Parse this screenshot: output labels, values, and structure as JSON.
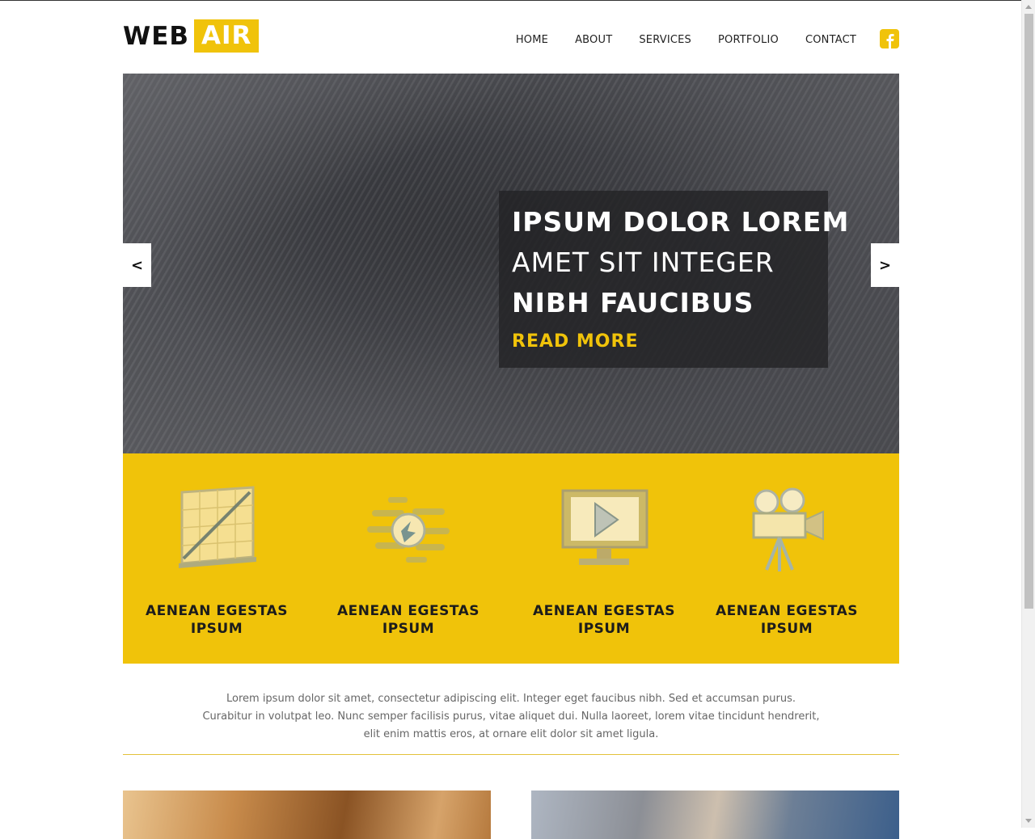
{
  "brand": {
    "part1": "WEB",
    "part2": "AIR",
    "accent": "#f0c30a"
  },
  "nav": {
    "items": [
      "HOME",
      "ABOUT",
      "SERVICES",
      "PORTFOLIO",
      "CONTACT"
    ],
    "social_icon": "facebook-icon"
  },
  "hero": {
    "line1": "IPSUM DOLOR LOREM",
    "line2": "AMET SIT INTEGER",
    "line3": "NIBH FAUCIBUS",
    "cta": "READ MORE",
    "prev": "<",
    "next": ">"
  },
  "features": [
    {
      "icon": "chart-icon",
      "line1": "AENEAN EGESTAS",
      "line2": "IPSUM"
    },
    {
      "icon": "globe-icon",
      "line1": "AENEAN EGESTAS",
      "line2": "IPSUM"
    },
    {
      "icon": "monitor-icon",
      "line1": "AENEAN EGESTAS",
      "line2": "IPSUM"
    },
    {
      "icon": "video-camera-icon",
      "line1": "AENEAN EGESTAS",
      "line2": "IPSUM"
    }
  ],
  "intro": "Lorem ipsum dolor sit amet, consectetur adipiscing elit. Integer eget faucibus nibh. Sed et accumsan purus. Curabitur in volutpat leo. Nunc semper facilisis purus, vitae aliquet dui. Nulla laoreet, lorem vitae tincidunt hendrerit, elit enim mattis eros, at ornare elit dolor sit amet ligula."
}
